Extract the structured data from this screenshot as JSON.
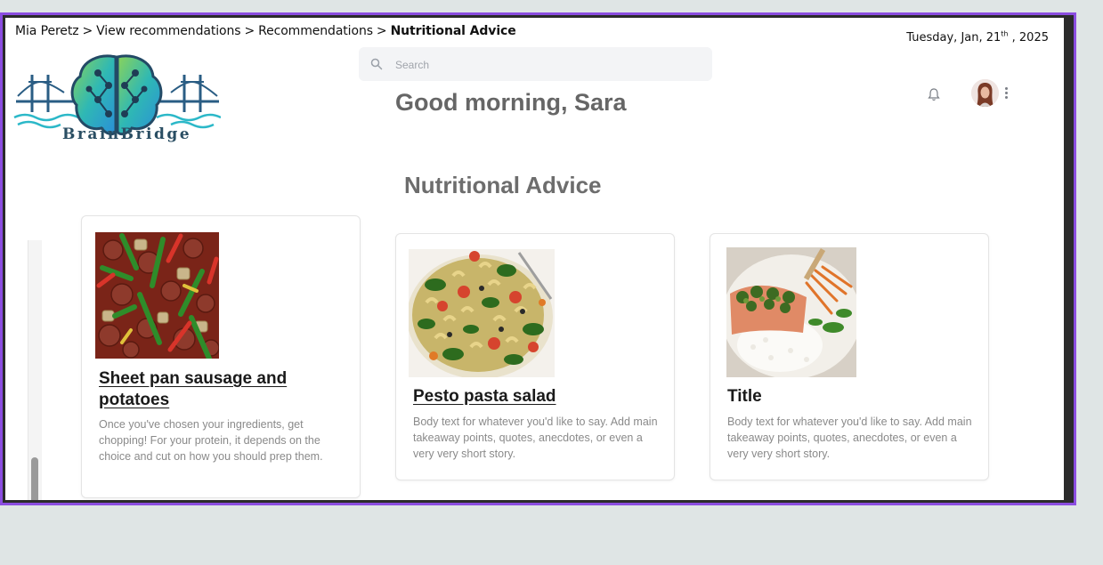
{
  "breadcrumb": {
    "items": [
      "Mia Peretz",
      "View recommendations",
      "Recommendations"
    ],
    "separator": ">",
    "current": "Nutritional Advice"
  },
  "date": {
    "prefix": "Tuesday,  Jan, 21",
    "suffix": "th",
    "year": " , 2025"
  },
  "logo": {
    "name": "BrainBridge",
    "icon": "brain-bridge-logo"
  },
  "search": {
    "placeholder": "Search",
    "icon": "search-icon"
  },
  "greeting": "Good morning, Sara",
  "header_icons": {
    "notification": "bell-icon",
    "user": "avatar",
    "menu": "kebab-menu-icon"
  },
  "section": {
    "title": "Nutritional Advice"
  },
  "cards": [
    {
      "title": "Sheet pan sausage and potatoes",
      "body": "Once you've chosen your ingredients, get chopping! For your protein, it depends on the choice and cut on how you should prep them.",
      "image": "sheet-pan-sausage-photo"
    },
    {
      "title": "Pesto pasta salad",
      "body": "Body text for whatever you'd like to say. Add main takeaway points, quotes, anecdotes, or even a very very short story.",
      "image": "pesto-pasta-photo"
    },
    {
      "title": "Title",
      "body": "Body text for whatever you'd like to say. Add main takeaway points, quotes, anecdotes, or even a very very short story.",
      "image": "salmon-rice-photo"
    }
  ],
  "colors": {
    "frame": "#8b4de0",
    "accent": "#2bb8c8",
    "background": "#dfe5e5"
  }
}
